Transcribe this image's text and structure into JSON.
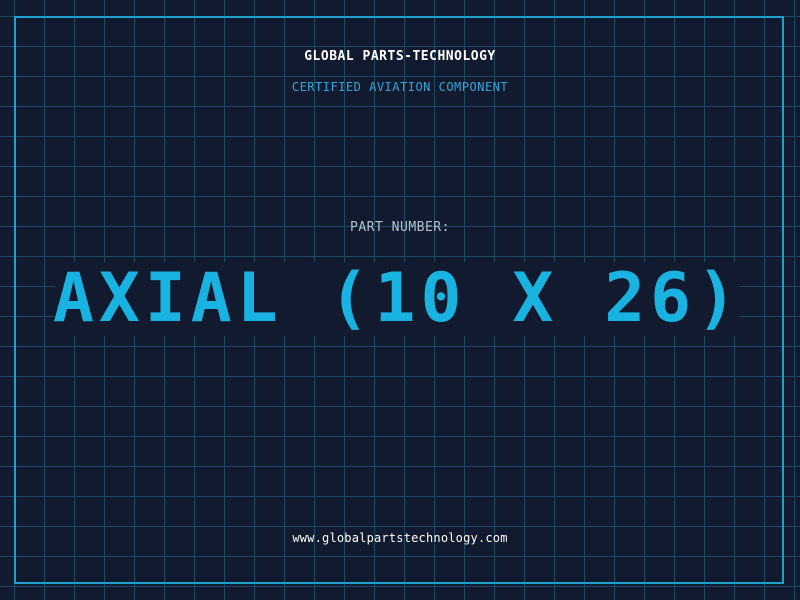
{
  "header": {
    "company": "GLOBAL PARTS-TECHNOLOGY",
    "subtitle": "CERTIFIED AVIATION COMPONENT"
  },
  "part": {
    "label": "PART NUMBER:",
    "number": "AXIAL (10 X 26)"
  },
  "footer": {
    "website": "www.globalpartstechnology.com"
  },
  "colors": {
    "background": "#111a2e",
    "grid": "#1d4a63",
    "frame": "#1e9fcc",
    "accent": "#18b3e0",
    "text": "#ffffff"
  }
}
